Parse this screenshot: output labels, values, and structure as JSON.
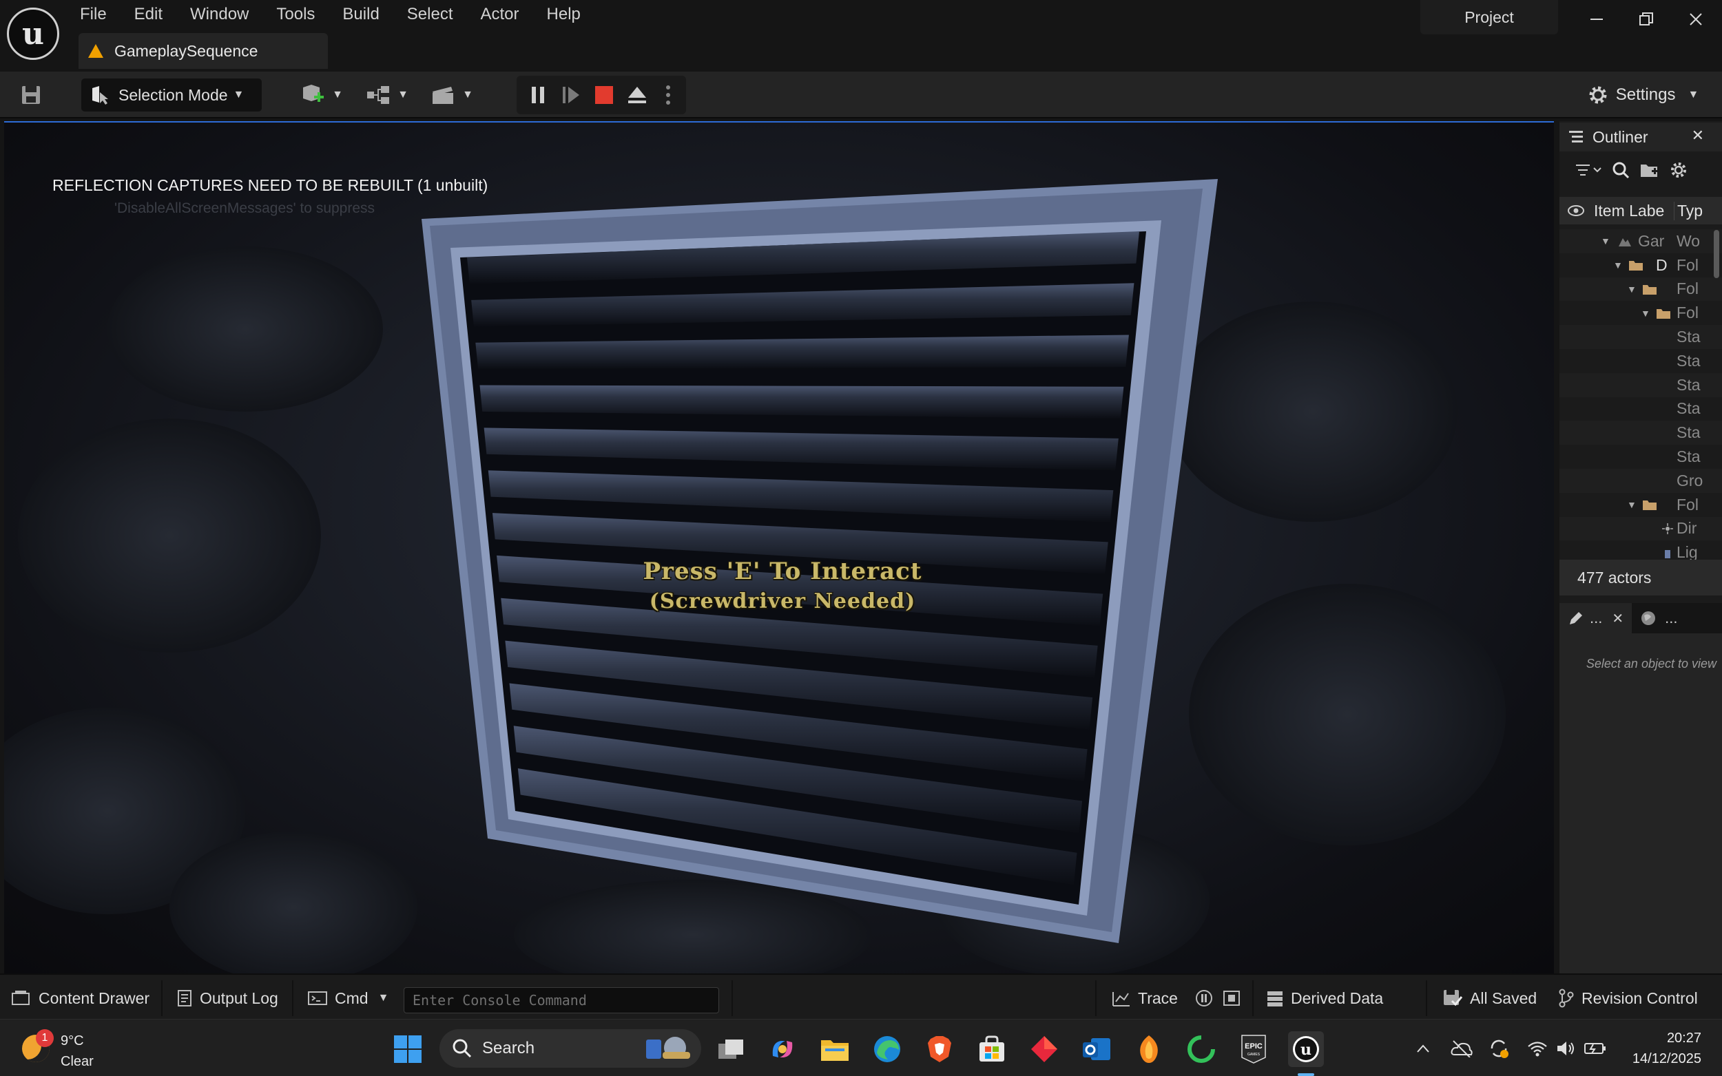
{
  "menu": {
    "items": [
      "File",
      "Edit",
      "Window",
      "Tools",
      "Build",
      "Select",
      "Actor",
      "Help"
    ],
    "project": "Project"
  },
  "tab": {
    "title": "GameplaySequence"
  },
  "toolbar": {
    "selection_mode": "Selection Mode",
    "settings": "Settings"
  },
  "viewport": {
    "rebuild_message": "REFLECTION CAPTURES NEED TO BE REBUILT (1 unbuilt)",
    "suppress_message": "'DisableAllScreenMessages' to suppress",
    "interact_line1": "Press 'E' To Interact",
    "interact_line2": "(Screwdriver Needed)"
  },
  "outliner": {
    "title": "Outliner",
    "col_label": "Item Labe",
    "col_type": "Typ",
    "rows": [
      {
        "label": "Gar",
        "type": "Wo"
      },
      {
        "label": "D",
        "type": "Fol"
      },
      {
        "label": "",
        "type": "Fol"
      },
      {
        "label": "",
        "type": "Fol"
      },
      {
        "label": "",
        "type": "Sta"
      },
      {
        "label": "",
        "type": "Sta"
      },
      {
        "label": "",
        "type": "Sta"
      },
      {
        "label": "",
        "type": "Sta"
      },
      {
        "label": "",
        "type": "Sta"
      },
      {
        "label": "",
        "type": "Sta"
      },
      {
        "label": "",
        "type": "Gro"
      },
      {
        "label": "",
        "type": "Fol"
      },
      {
        "label": "",
        "type": "Dir"
      },
      {
        "label": "",
        "type": "Lig"
      }
    ],
    "actor_count": "477 actors"
  },
  "details": {
    "tab1": "...",
    "tab2": "...",
    "hint": "Select an object to view"
  },
  "statusbar": {
    "content_drawer": "Content Drawer",
    "output_log": "Output Log",
    "cmd": "Cmd",
    "console_placeholder": "Enter Console Command",
    "trace": "Trace",
    "derived_data": "Derived Data",
    "all_saved": "All Saved",
    "revision_control": "Revision Control"
  },
  "taskbar": {
    "weather_badge": "1",
    "temperature": "9°C",
    "condition": "Clear",
    "search": "Search",
    "time": "20:27",
    "date": "14/12/2025"
  },
  "colors": {
    "accent": "#2d6bd6",
    "warning": "#f0a000",
    "stop": "#e23b2e",
    "interact_text": "#c9b869"
  }
}
